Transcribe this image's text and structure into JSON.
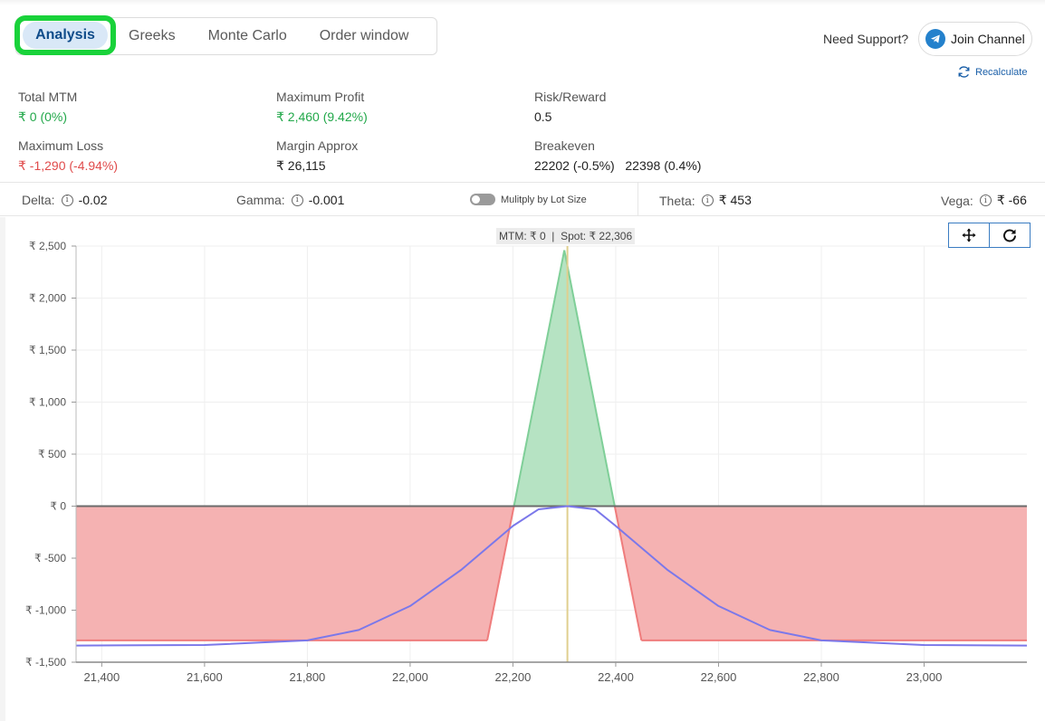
{
  "tabs": [
    {
      "label": "Analysis",
      "active": true
    },
    {
      "label": "Greeks"
    },
    {
      "label": "Monte Carlo"
    },
    {
      "label": "Order window"
    }
  ],
  "support": {
    "label": "Need Support?",
    "join_label": "Join Channel",
    "recalculate_label": "Recalculate"
  },
  "stats": {
    "total_mtm": {
      "label": "Total MTM",
      "value": "₹ 0 (0%)"
    },
    "max_profit": {
      "label": "Maximum Profit",
      "value": "₹ 2,460 (9.42%)"
    },
    "risk_reward": {
      "label": "Risk/Reward",
      "value": "0.5"
    },
    "max_loss": {
      "label": "Maximum Loss",
      "value": "₹ -1,290 (-4.94%)"
    },
    "margin": {
      "label": "Margin Approx",
      "value": "₹ 26,115"
    },
    "breakeven": {
      "label": "Breakeven",
      "value": "22202 (-0.5%)   22398 (0.4%)"
    }
  },
  "greeks": {
    "delta": {
      "label": "Delta:",
      "value": "-0.02"
    },
    "gamma": {
      "label": "Gamma:",
      "value": "-0.001"
    },
    "lot_toggle_label": "Mulitply by Lot Size",
    "lot_toggle_on": false,
    "theta": {
      "label": "Theta:",
      "value": "₹ 453"
    },
    "vega": {
      "label": "Vega:",
      "value": "₹ -66"
    }
  },
  "colors": {
    "accent": "#0f4c8a",
    "highlight": "#19d23a",
    "profit": "#22a84a",
    "loss": "#e04b4b",
    "profit_fill": "#b6e3c3",
    "loss_fill": "#f5b2b2",
    "target_line": "#7b78ea",
    "spot_line": "#e0cf8f"
  },
  "chart_data": {
    "type": "area",
    "hover_label": "MTM: ₹ 0  |  Spot: ₹ 22,306",
    "xlim": [
      21350,
      23200
    ],
    "ylim": [
      -1500,
      2500
    ],
    "x_ticks": [
      21400,
      21600,
      21800,
      22000,
      22200,
      22400,
      22600,
      22800,
      23000
    ],
    "x_tick_labels": [
      "21,400",
      "21,600",
      "21,800",
      "22,000",
      "22,200",
      "22,400",
      "22,600",
      "22,800",
      "23,000"
    ],
    "y_ticks": [
      2500,
      2000,
      1500,
      1000,
      500,
      0,
      -500,
      -1000,
      -1500
    ],
    "y_tick_labels": [
      "₹ 2,500",
      "₹ 2,000",
      "₹ 1,500",
      "₹ 1,000",
      "₹ 500",
      "₹ 0",
      "₹ -500",
      "₹ -1,000",
      "₹ -1,500"
    ],
    "grid": true,
    "spot": 22306,
    "series": [
      {
        "kind": "expiry",
        "points": [
          [
            21350,
            -1290
          ],
          [
            22150,
            -1290
          ],
          [
            22202,
            0
          ],
          [
            22300,
            2460
          ],
          [
            22398,
            0
          ],
          [
            22450,
            -1290
          ],
          [
            23200,
            -1290
          ]
        ]
      },
      {
        "kind": "target",
        "points": [
          [
            21350,
            -1340
          ],
          [
            21600,
            -1335
          ],
          [
            21800,
            -1290
          ],
          [
            21900,
            -1190
          ],
          [
            22000,
            -960
          ],
          [
            22100,
            -610
          ],
          [
            22200,
            -190
          ],
          [
            22250,
            -30
          ],
          [
            22306,
            0
          ],
          [
            22360,
            -30
          ],
          [
            22400,
            -190
          ],
          [
            22500,
            -610
          ],
          [
            22600,
            -960
          ],
          [
            22700,
            -1190
          ],
          [
            22800,
            -1290
          ],
          [
            23000,
            -1335
          ],
          [
            23200,
            -1340
          ]
        ]
      }
    ]
  }
}
